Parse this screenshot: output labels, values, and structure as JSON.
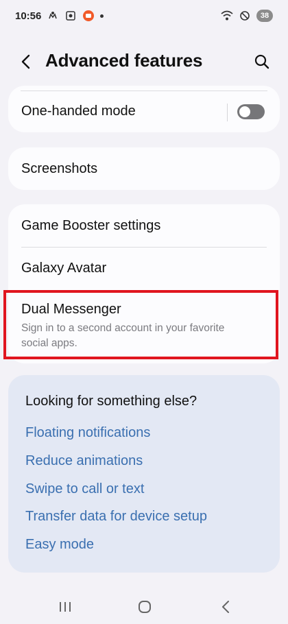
{
  "status_bar": {
    "time": "10:56",
    "battery": "38",
    "icons": [
      "wifi-calling-icon",
      "screen-recorder-icon",
      "app-notification-icon",
      "more-dot-icon",
      "wifi-icon",
      "dnd-icon",
      "battery-icon"
    ]
  },
  "header": {
    "title": "Advanced features",
    "back_icon": "back-icon",
    "search_icon": "search-icon"
  },
  "settings": {
    "one_handed": {
      "label": "One-handed mode",
      "toggle_on": false
    },
    "screenshots": {
      "label": "Screenshots"
    },
    "game_booster": {
      "label": "Game Booster settings"
    },
    "galaxy_avatar": {
      "label": "Galaxy Avatar"
    },
    "dual_messenger": {
      "label": "Dual Messenger",
      "description": "Sign in to a second account in your favorite social apps."
    }
  },
  "suggestions": {
    "title": "Looking for something else?",
    "links": [
      "Floating notifications",
      "Reduce animations",
      "Swipe to call or text",
      "Transfer data for device setup",
      "Easy mode"
    ]
  },
  "colors": {
    "highlight": "#e0151f",
    "link": "#3a6fb0",
    "suggestion_bg": "#e3e8f4"
  }
}
